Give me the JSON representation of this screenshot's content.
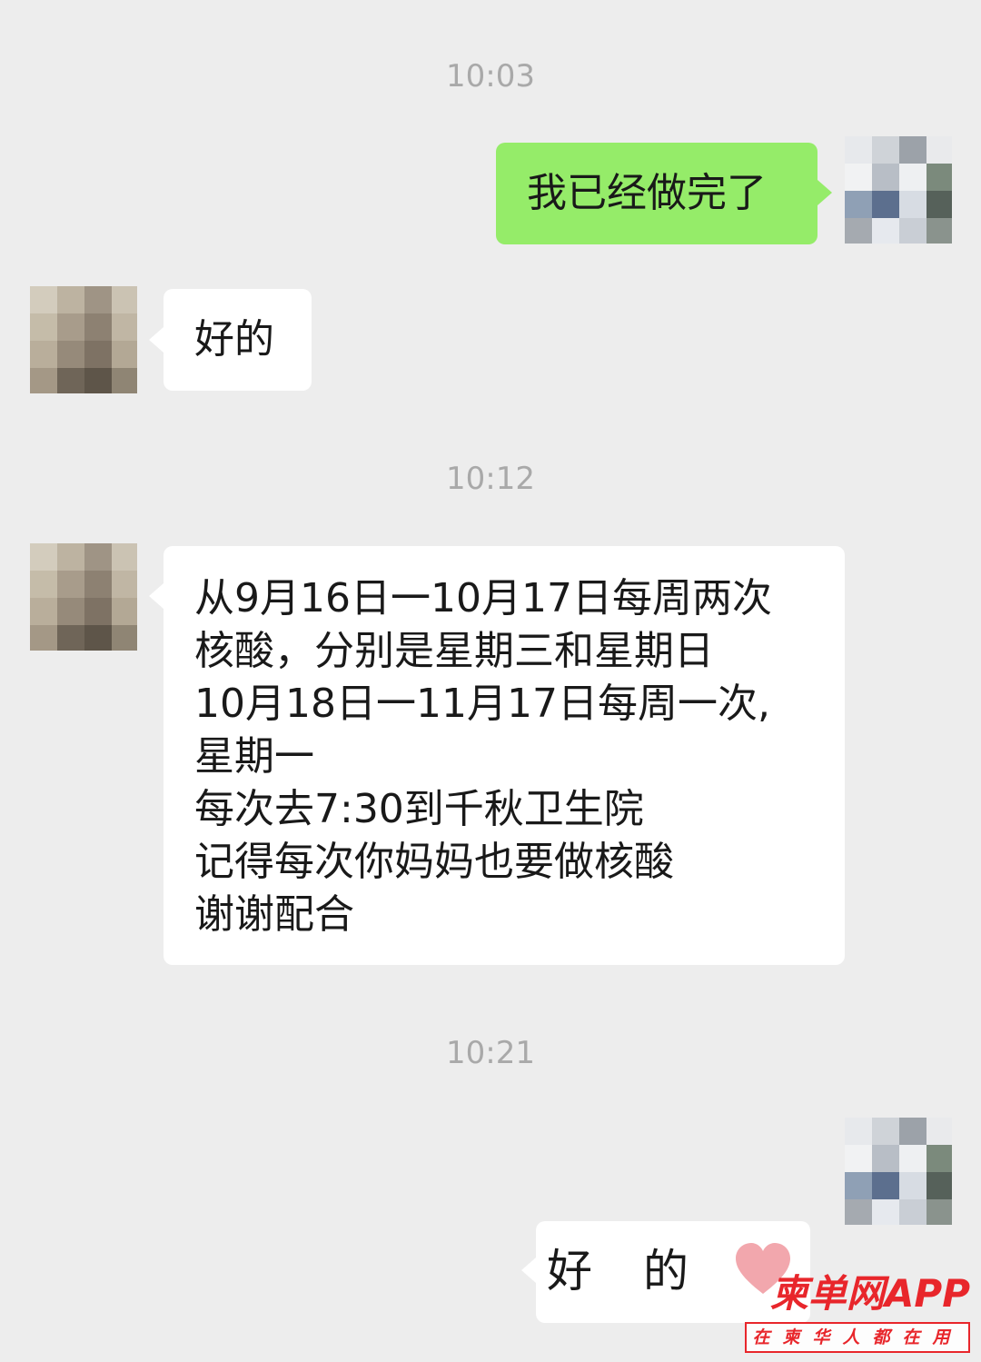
{
  "chat": {
    "timestamps": [
      "10:03",
      "10:12",
      "10:21"
    ],
    "messages": [
      {
        "side": "right",
        "text": "我已经做完了"
      },
      {
        "side": "left",
        "text": "好的"
      },
      {
        "side": "left",
        "lines": [
          "从9月16日一10月17日每周两次",
          "核酸，分别是星期三和星期日",
          "10月18日一11月17日每周一次,",
          "星期一",
          "每次去7:30到千秋卫生院",
          "记得每次你妈妈也要做核酸",
          "谢谢配合"
        ]
      },
      {
        "side": "right",
        "text": "好的",
        "emoji": "heart-icon"
      }
    ]
  },
  "colors": {
    "background": "#ededed",
    "green_bubble": "#95ec69",
    "white_bubble": "#ffffff",
    "heart": "#f2a7ad",
    "watermark": "#e8262b"
  },
  "watermark": {
    "brand": "柬单网APP",
    "tagline": "在柬华人都在用"
  }
}
